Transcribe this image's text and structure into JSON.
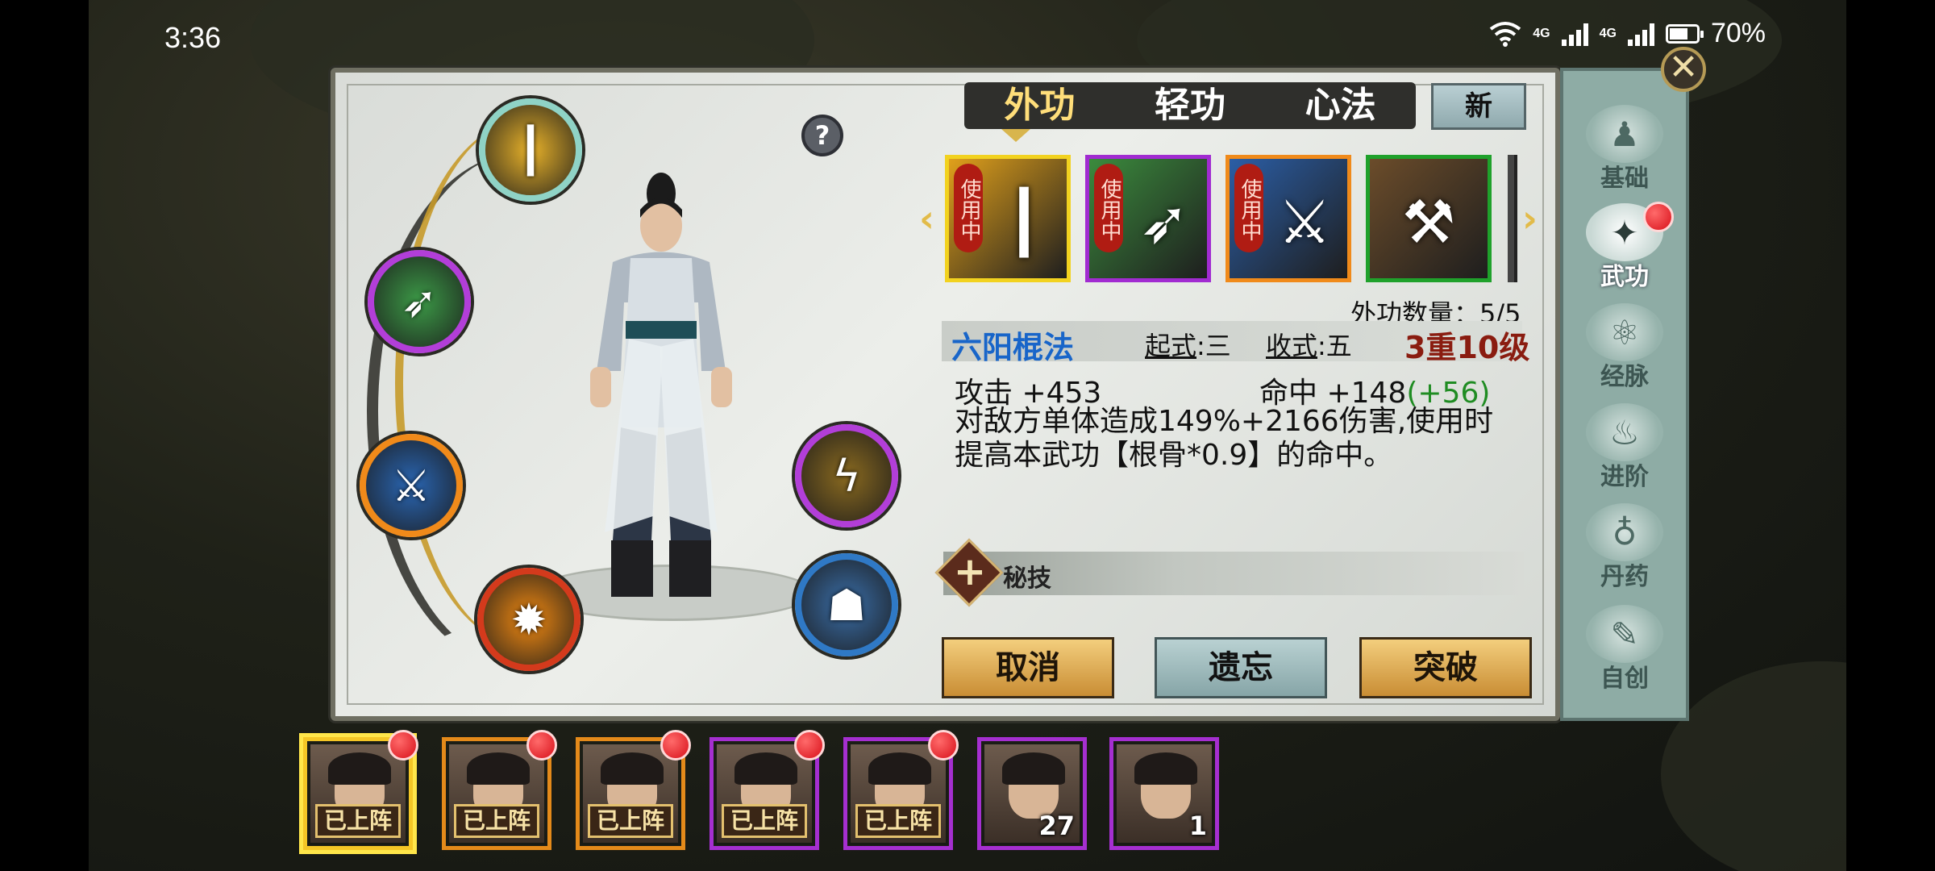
{
  "status": {
    "time": "3:36",
    "network_1": "4G",
    "network_2": "4G",
    "battery": "70%"
  },
  "tabs": [
    {
      "label": "外功",
      "active": true
    },
    {
      "label": "轻功",
      "active": false
    },
    {
      "label": "心法",
      "active": false
    }
  ],
  "new_button": "新",
  "help_button": "?",
  "close_button": "✕",
  "skill_cards": [
    {
      "stamp": "使用中",
      "icon": "staff-icon",
      "border": "#f2d21f",
      "bg": "#e0a01b"
    },
    {
      "stamp": "使用中",
      "icon": "spear-icon",
      "border": "#a12bd1",
      "bg": "#3b8b3d"
    },
    {
      "stamp": "使用中",
      "icon": "blade-icon",
      "border": "#f08a1a",
      "bg": "#2b5ea6"
    },
    {
      "stamp": "",
      "icon": "nunchaku-icon",
      "border": "#1fa12b",
      "bg": "#6b4c2a"
    }
  ],
  "skill_count": "外功数量：5/5",
  "skill": {
    "name": "六阳棍法",
    "qishi_key": "起式",
    "qishi_value": ":三",
    "shoushi_key": "收式",
    "shoushi_value": ":五",
    "level": "3重10级",
    "attack": "攻击 +453",
    "hit": "命中 +148",
    "hit_bonus": "(+56)",
    "description": "对敌方单体造成149%+2166伤害,使用时提高本武功【根骨*0.9】的命中。"
  },
  "secret": {
    "label": "秘技"
  },
  "buttons": {
    "cancel": "取消",
    "forget": "遗忘",
    "breakthrough": "突破"
  },
  "side_tabs": [
    {
      "label": "基础",
      "icon": "figure-icon",
      "active": false,
      "dot": false
    },
    {
      "label": "武功",
      "icon": "kungfu-icon",
      "active": true,
      "dot": true
    },
    {
      "label": "经脉",
      "icon": "meridian-icon",
      "active": false,
      "dot": false
    },
    {
      "label": "进阶",
      "icon": "flame-icon",
      "active": false,
      "dot": false
    },
    {
      "label": "丹药",
      "icon": "gourd-icon",
      "active": false,
      "dot": false
    },
    {
      "label": "自创",
      "icon": "book-icon",
      "active": false,
      "dot": false
    }
  ],
  "equipped_circles": [
    {
      "icon": "staff-icon",
      "ring": "#8fd3c6",
      "bg": "#e8b22a"
    },
    {
      "icon": "spear-icon",
      "ring": "#b23ed8",
      "bg": "#3c9a47"
    },
    {
      "icon": "blade-icon",
      "ring": "#f08a1a",
      "bg": "#2a67b5"
    },
    {
      "icon": "fire-icon",
      "ring": "#d43a1c",
      "bg": "#f28a12"
    },
    {
      "icon": "swirl-icon",
      "ring": "#b23ed8",
      "bg": "#8a6a20"
    },
    {
      "icon": "silhouette-icon",
      "ring": "#2f79c6",
      "bg": "#3a6ea8"
    }
  ],
  "roster": [
    {
      "tag": "已上阵",
      "num": "",
      "border": "#f4c626",
      "dot": true,
      "selected": true
    },
    {
      "tag": "已上阵",
      "num": "",
      "border": "#e48a1a",
      "dot": true,
      "selected": false
    },
    {
      "tag": "已上阵",
      "num": "",
      "border": "#e48a1a",
      "dot": true,
      "selected": false
    },
    {
      "tag": "已上阵",
      "num": "",
      "border": "#a52fd0",
      "dot": true,
      "selected": false
    },
    {
      "tag": "已上阵",
      "num": "",
      "border": "#a52fd0",
      "dot": true,
      "selected": false
    },
    {
      "tag": "",
      "num": "27",
      "border": "#a52fd0",
      "dot": false,
      "selected": false
    },
    {
      "tag": "",
      "num": "1",
      "border": "#a52fd0",
      "dot": false,
      "selected": false
    }
  ]
}
